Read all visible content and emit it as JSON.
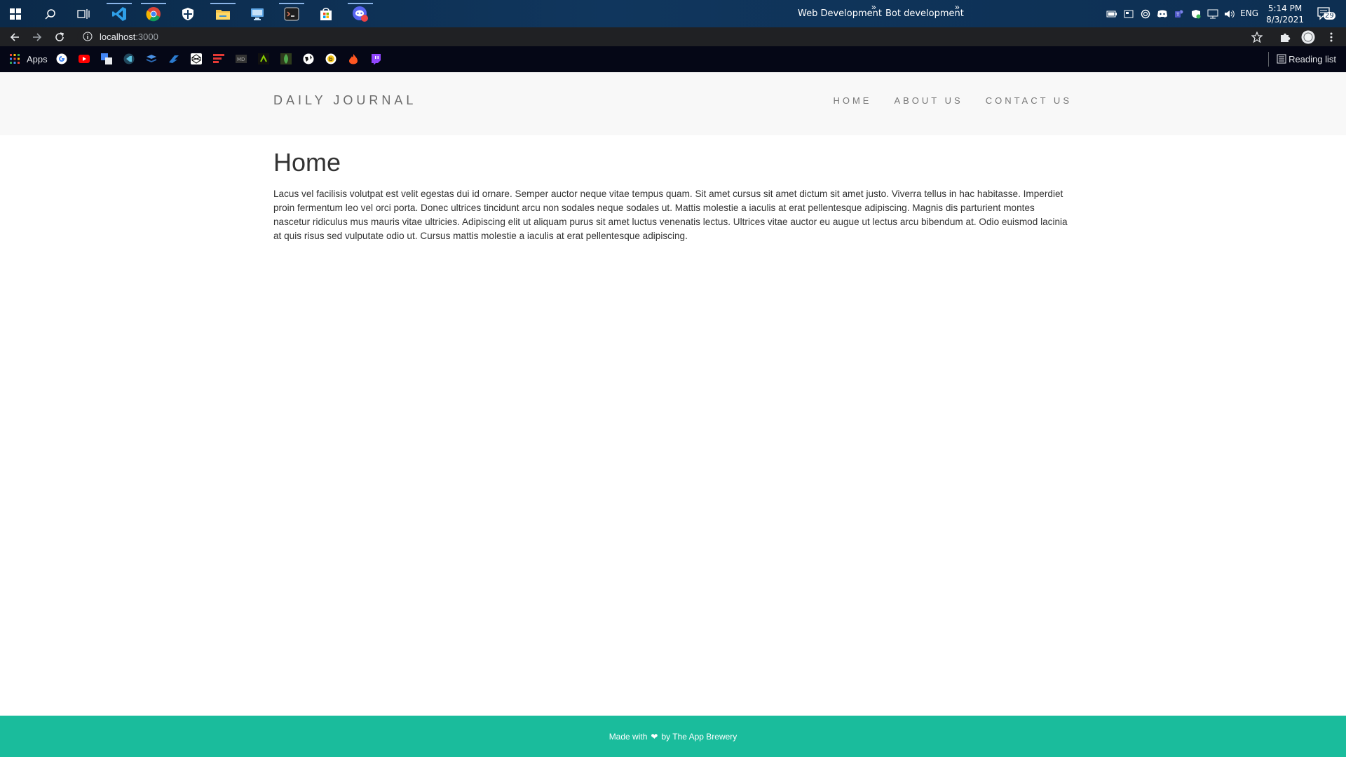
{
  "taskbar": {
    "links": [
      {
        "label": "Web Development"
      },
      {
        "label": "Bot development"
      }
    ],
    "chevron": "»",
    "language": "ENG",
    "time": "5:14 PM",
    "date": "8/3/2021",
    "notification_count": "29"
  },
  "browser": {
    "url_host": "localhost",
    "url_port": ":3000"
  },
  "bookmarks": {
    "apps_label": "Apps",
    "reading_list": "Reading list"
  },
  "site": {
    "brand": "DAILY JOURNAL",
    "nav": [
      "HOME",
      "ABOUT US",
      "CONTACT US"
    ],
    "heading": "Home",
    "body": "Lacus vel facilisis volutpat est velit egestas dui id ornare. Semper auctor neque vitae tempus quam. Sit amet cursus sit amet dictum sit amet justo. Viverra tellus in hac habitasse. Imperdiet proin fermentum leo vel orci porta. Donec ultrices tincidunt arcu non sodales neque sodales ut. Mattis molestie a iaculis at erat pellentesque adipiscing. Magnis dis parturient montes nascetur ridiculus mus mauris vitae ultricies. Adipiscing elit ut aliquam purus sit amet luctus venenatis lectus. Ultrices vitae auctor eu augue ut lectus arcu bibendum at. Odio euismod lacinia at quis risus sed vulputate odio ut. Cursus mattis molestie a iaculis at erat pellentesque adipiscing.",
    "footer_prefix": "Made with",
    "footer_suffix": "by The App Brewery"
  },
  "colors": {
    "footer": "#1abc9c",
    "header": "#f8f8f8",
    "heart": "#e31b23"
  }
}
